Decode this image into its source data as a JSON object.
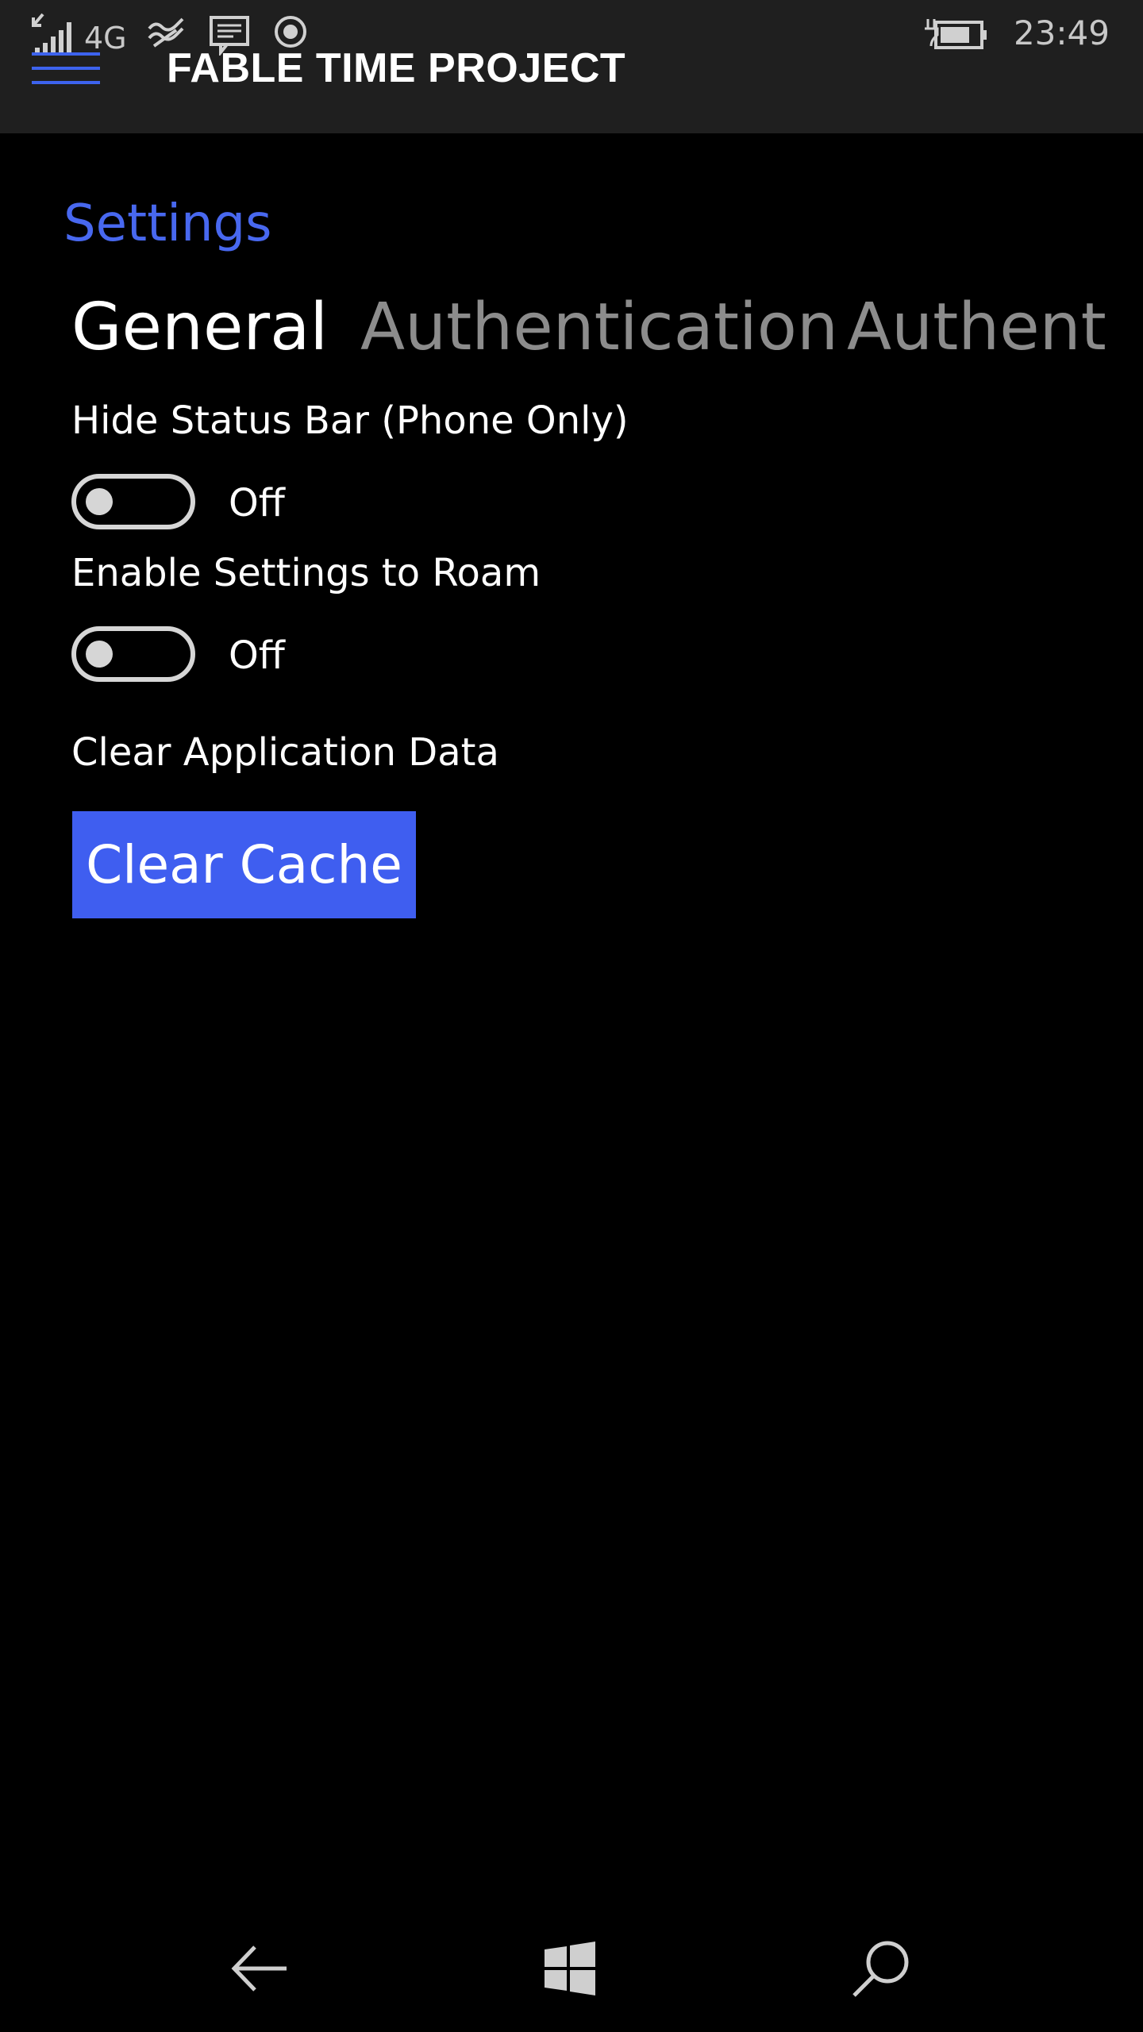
{
  "status_bar": {
    "network": "4G",
    "time": "23:49"
  },
  "app": {
    "title": "FABLE TIME PROJECT"
  },
  "page": {
    "heading": "Settings"
  },
  "tabs": [
    {
      "label": "General",
      "active": true
    },
    {
      "label": "Authentication",
      "active": false
    },
    {
      "label": "Authent",
      "active": false
    }
  ],
  "settings": {
    "hide_status_bar": {
      "label": "Hide Status Bar (Phone Only)",
      "state": "Off"
    },
    "roam": {
      "label": "Enable Settings to Roam",
      "state": "Off"
    },
    "clear_data": {
      "label": "Clear Application Data",
      "button": "Clear Cache"
    }
  },
  "colors": {
    "accent": "#3f5ef0",
    "heading": "#4868ef",
    "topbar": "#1f1f1f",
    "background": "#000000"
  },
  "icons": {
    "status": [
      "signal-icon",
      "wifi-hotspot-icon",
      "message-icon",
      "location-icon",
      "battery-charging-icon"
    ],
    "nav": [
      "back-arrow-icon",
      "windows-start-icon",
      "search-icon"
    ]
  }
}
